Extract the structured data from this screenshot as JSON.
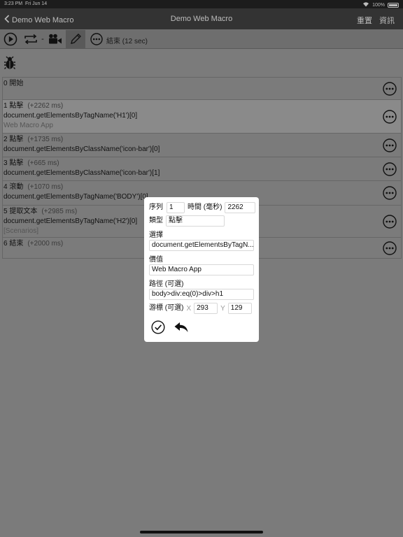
{
  "status_bar": {
    "time": "3:23 PM",
    "date": "Fri Jun 14",
    "battery": "100%"
  },
  "nav": {
    "back_label": "Demo Web Macro",
    "title": "Demo Web Macro",
    "reset_label": "重置",
    "info_label": "資訊"
  },
  "toolbar": {
    "repeat_separator": "-",
    "status": "結束 (12 sec)"
  },
  "steps": [
    {
      "head": "0 開始",
      "ms": "",
      "expr": "",
      "extra": ""
    },
    {
      "head": "1 點擊",
      "ms": "(+2262 ms)",
      "expr": "document.getElementsByTagName('H1')[0]",
      "extra": "Web Macro App"
    },
    {
      "head": "2 點擊",
      "ms": "(+1735 ms)",
      "expr": "document.getElementsByClassName('icon-bar')[0]",
      "extra": ""
    },
    {
      "head": "3 點擊",
      "ms": "(+665 ms)",
      "expr": "document.getElementsByClassName('icon-bar')[1]",
      "extra": ""
    },
    {
      "head": "4 滾動",
      "ms": "(+1070 ms)",
      "expr": "document.getElementsByTagName('BODY')[0]",
      "extra": ""
    },
    {
      "head": "5 提取文本",
      "ms": "(+2985 ms)",
      "expr": "document.getElementsByTagName('H2')[0]",
      "extra": "[Scenarios]"
    },
    {
      "head": "6 結束",
      "ms": "(+2000 ms)",
      "expr": "",
      "extra": ""
    }
  ],
  "dialog": {
    "seq_label": "序列",
    "seq_value": "1",
    "time_label": "時間 (毫秒)",
    "time_value": "2262",
    "type_label": "類型",
    "type_value": "點擊",
    "select_label": "選擇",
    "select_value": "document.getElementsByTagN...",
    "value_label": "價值",
    "value_value": "Web Macro App",
    "path_label": "路徑 (可選)",
    "path_value": "body>div:eq(0)>div>h1",
    "cursor_label": "游標 (可選)",
    "x_label": "X",
    "x_value": "293",
    "y_label": "Y",
    "y_value": "129"
  }
}
